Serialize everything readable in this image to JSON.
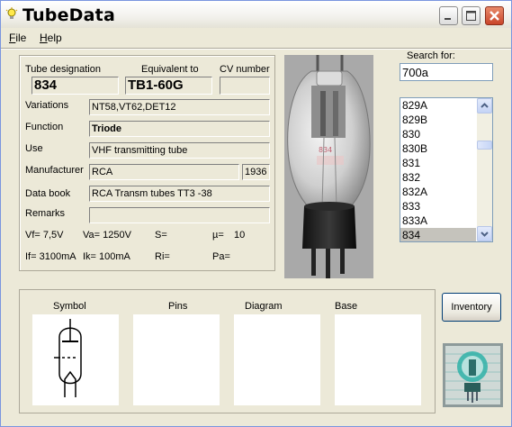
{
  "window": {
    "title": "TubeData"
  },
  "menu": {
    "file": "File",
    "help": "Help"
  },
  "labels": {
    "tube_designation": "Tube designation",
    "equivalent_to": "Equivalent to",
    "cv_number": "CV number",
    "variations": "Variations",
    "function": "Function",
    "use": "Use",
    "manufacturer": "Manufacturer",
    "data_book": "Data book",
    "remarks": "Remarks"
  },
  "tube": {
    "designation": "834",
    "equivalent": "TB1-60G",
    "cv_number": "",
    "variations": "NT58,VT62,DET12",
    "function": "Triode",
    "use": "VHF transmitting tube",
    "manufacturer": "RCA",
    "year": "1936",
    "data_book": "RCA Transm tubes TT3 -38",
    "remarks": ""
  },
  "params": {
    "vf": "Vf= 7,5V",
    "va": "Va= 1250V",
    "s": "S=",
    "mu_label": "µ=",
    "mu_value": "10",
    "if": "If= 3100mA",
    "ik": "Ik=  100mA",
    "ri": "Ri=",
    "pa": "Pa="
  },
  "search": {
    "label": "Search for:",
    "value": "700a",
    "results": [
      "829A",
      "829B",
      "830",
      "830B",
      "831",
      "832",
      "832A",
      "833",
      "833A",
      "834"
    ],
    "selected_index": 9
  },
  "panels": {
    "symbol": "Symbol",
    "pins": "Pins",
    "diagram": "Diagram",
    "base": "Base"
  },
  "buttons": {
    "inventory": "Inventory"
  },
  "colors": {
    "title_close": "#c9452a",
    "selection": "#c5c3bc",
    "panel_bg": "#ffffff"
  }
}
